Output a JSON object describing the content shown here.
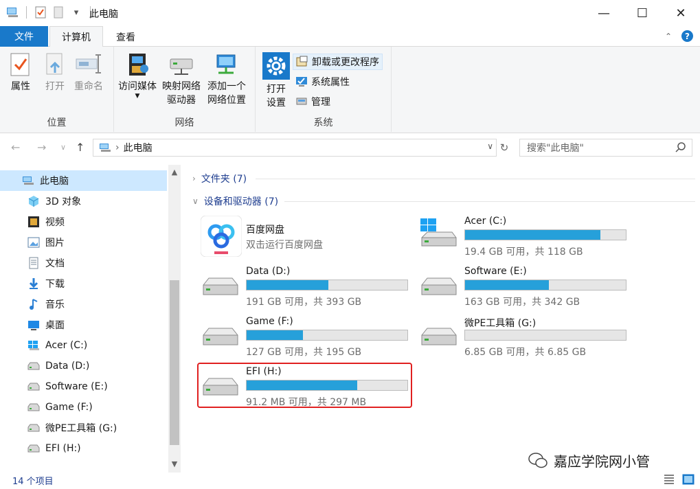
{
  "window": {
    "title": "此电脑"
  },
  "tabs": {
    "file": "文件",
    "computer": "计算机",
    "view": "查看"
  },
  "ribbon": {
    "location": {
      "label": "位置",
      "properties": "属性",
      "open": "打开",
      "rename": "重命名"
    },
    "network": {
      "label": "网络",
      "access_media": "访问媒体",
      "map_drive_1": "映射网络",
      "map_drive_2": "驱动器",
      "add_location_1": "添加一个",
      "add_location_2": "网络位置"
    },
    "system": {
      "label": "系统",
      "open_settings_1": "打开",
      "open_settings_2": "设置",
      "uninstall": "卸载或更改程序",
      "system_props": "系统属性",
      "manage": "管理"
    }
  },
  "address": {
    "crumb": "此电脑"
  },
  "search": {
    "placeholder": "搜索\"此电脑\""
  },
  "nav": {
    "items": [
      {
        "label": "此电脑",
        "icon": "pc-icon"
      },
      {
        "label": "3D 对象",
        "icon": "3d-objects-icon"
      },
      {
        "label": "视频",
        "icon": "video-icon"
      },
      {
        "label": "图片",
        "icon": "pictures-icon"
      },
      {
        "label": "文档",
        "icon": "documents-icon"
      },
      {
        "label": "下载",
        "icon": "download-icon"
      },
      {
        "label": "音乐",
        "icon": "music-icon"
      },
      {
        "label": "桌面",
        "icon": "desktop-icon"
      },
      {
        "label": "Acer (C:)",
        "icon": "windows-drive-icon"
      },
      {
        "label": "Data (D:)",
        "icon": "drive-icon"
      },
      {
        "label": "Software (E:)",
        "icon": "drive-icon"
      },
      {
        "label": "Game (F:)",
        "icon": "drive-icon"
      },
      {
        "label": "微PE工具箱 (G:)",
        "icon": "drive-icon"
      },
      {
        "label": "EFI (H:)",
        "icon": "drive-icon"
      }
    ]
  },
  "content": {
    "folders_section": "文件夹 (7)",
    "devices_section": "设备和驱动器 (7)",
    "baidu": {
      "name": "百度网盘",
      "desc": "双击运行百度网盘"
    },
    "drives": [
      {
        "name": "Acer (C:)",
        "info": "19.4 GB 可用，共 118 GB",
        "used_fraction": 0.84
      },
      {
        "name": "Data (D:)",
        "info": "191 GB 可用，共 393 GB",
        "used_fraction": 0.51
      },
      {
        "name": "Software (E:)",
        "info": "163 GB 可用，共 342 GB",
        "used_fraction": 0.52
      },
      {
        "name": "Game (F:)",
        "info": "127 GB 可用，共 195 GB",
        "used_fraction": 0.35
      },
      {
        "name": "微PE工具箱 (G:)",
        "info": "6.85 GB 可用，共 6.85 GB",
        "used_fraction": 0.0
      },
      {
        "name": "EFI (H:)",
        "info": "91.2 MB 可用，共 297 MB",
        "used_fraction": 0.69
      }
    ]
  },
  "status": {
    "count": "14 个项目"
  },
  "watermark": {
    "text": "嘉应学院网小管"
  },
  "colors": {
    "accent": "#1979ca",
    "bar_fill": "#26a0da",
    "highlight": "#e02020",
    "selection": "#cde8ff"
  }
}
